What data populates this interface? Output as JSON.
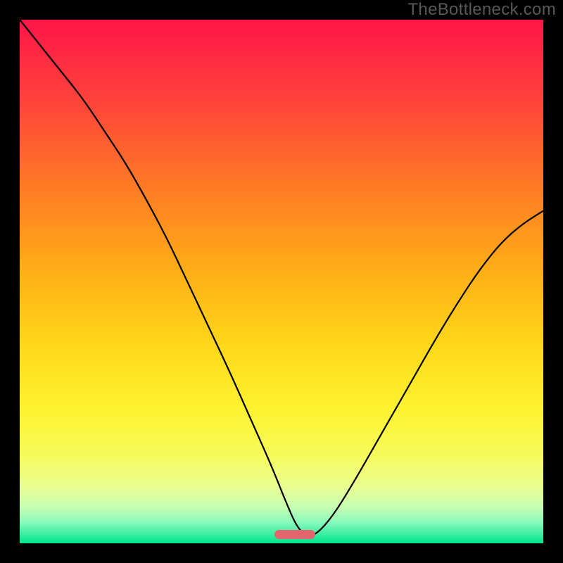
{
  "watermark": "TheBottleneck.com",
  "colors": {
    "gradient_stops": [
      {
        "pct": 0,
        "hex": "#ff1649"
      },
      {
        "pct": 15,
        "hex": "#ff413b"
      },
      {
        "pct": 32,
        "hex": "#ff7b25"
      },
      {
        "pct": 48,
        "hex": "#ffae17"
      },
      {
        "pct": 62,
        "hex": "#ffd71a"
      },
      {
        "pct": 74,
        "hex": "#fef22e"
      },
      {
        "pct": 83,
        "hex": "#f7fb5a"
      },
      {
        "pct": 89,
        "hex": "#eafe90"
      },
      {
        "pct": 93,
        "hex": "#c8ffb2"
      },
      {
        "pct": 96,
        "hex": "#88f9bb"
      },
      {
        "pct": 100,
        "hex": "#00e58e"
      }
    ],
    "curve_stroke": "#000000",
    "pill_fill": "#e2646d"
  },
  "pill": {
    "x_pct": 52.5,
    "y_pct": 98.3,
    "w_pct": 7.8,
    "h_pct": 1.8
  },
  "chart_data": {
    "type": "line",
    "title": "",
    "xlabel": "",
    "ylabel": "",
    "xlim": [
      0,
      100
    ],
    "ylim": [
      0,
      100
    ],
    "series": [
      {
        "name": "bottleneck_curve",
        "x": [
          0,
          4,
          8,
          12,
          16,
          20,
          24,
          28,
          32,
          36,
          40,
          44,
          48,
          51,
          53,
          55,
          57,
          60,
          64,
          68,
          72,
          76,
          80,
          84,
          88,
          92,
          96,
          100
        ],
        "y": [
          100,
          95,
          90,
          85,
          79,
          73,
          66,
          58.5,
          50,
          41.5,
          33,
          24,
          15,
          7.5,
          3,
          1.2,
          2.0,
          5.5,
          12,
          19,
          26,
          33,
          40,
          46.5,
          52.5,
          57.5,
          61,
          63.5
        ]
      }
    ],
    "optimal_zone_x": [
      49,
      57
    ]
  }
}
